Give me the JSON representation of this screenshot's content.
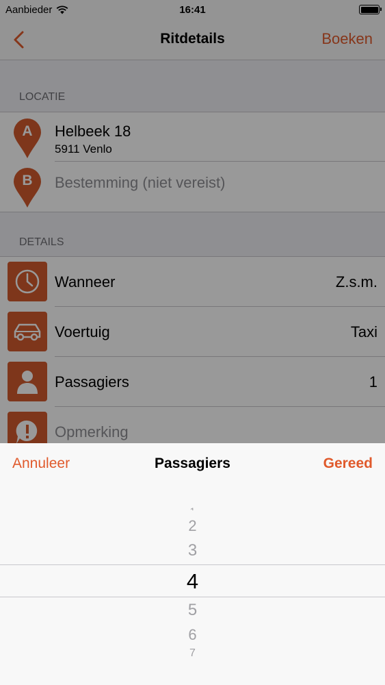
{
  "status_bar": {
    "carrier": "Aanbieder",
    "time": "16:41"
  },
  "nav": {
    "title": "Ritdetails",
    "action": "Boeken",
    "back_icon": "chevron-left-icon"
  },
  "colors": {
    "accent": "#e05a2c",
    "icon_bg": "#d25a2e"
  },
  "location": {
    "header": "LOCATIE",
    "a": {
      "letter": "A",
      "title": "Helbeek 18",
      "subtitle": "5911 Venlo"
    },
    "b": {
      "letter": "B",
      "placeholder": "Bestemming (niet vereist)"
    }
  },
  "details": {
    "header": "DETAILS",
    "rows": [
      {
        "label": "Wanneer",
        "value": "Z.s.m.",
        "icon": "clock-icon"
      },
      {
        "label": "Voertuig",
        "value": "Taxi",
        "icon": "car-icon"
      },
      {
        "label": "Passagiers",
        "value": "1",
        "icon": "person-icon"
      },
      {
        "label": "Opmerking",
        "icon": "comment-icon"
      }
    ]
  },
  "picker": {
    "cancel": "Annuleer",
    "title": "Passagiers",
    "done": "Gereed",
    "items": [
      "1",
      "2",
      "3",
      "4",
      "5",
      "6",
      "7"
    ],
    "selected": "4"
  }
}
